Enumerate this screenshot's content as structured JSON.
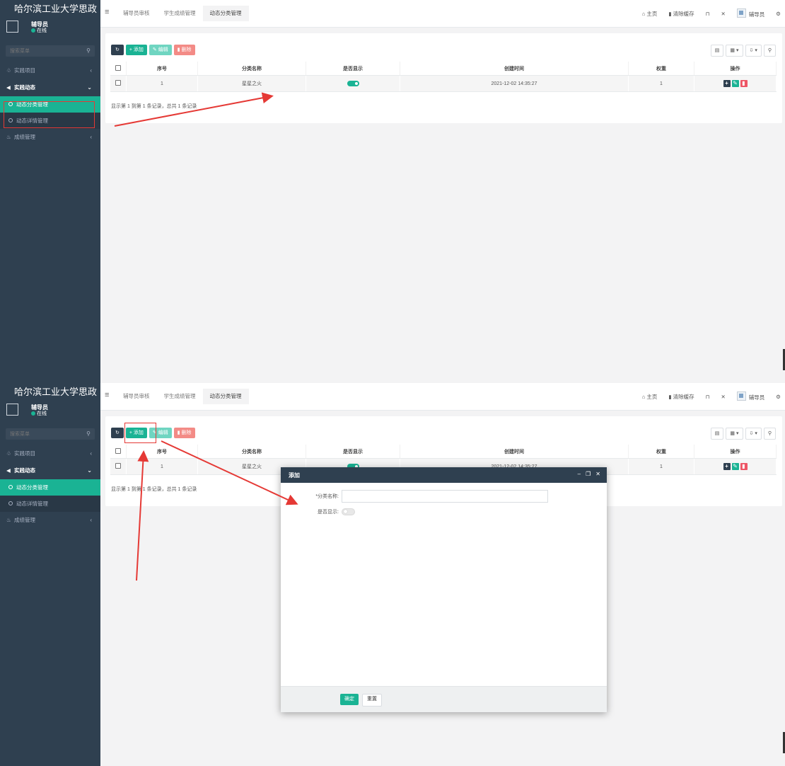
{
  "app": {
    "brand": "哈尔滨工业大学思政",
    "user_name": "辅导员",
    "user_status": "在线",
    "search_placeholder": "搜索菜单"
  },
  "menu": {
    "items": [
      {
        "label": "实践项目",
        "icon": "sitemap-icon"
      },
      {
        "label": "实践动态",
        "icon": "volume-icon"
      },
      {
        "label": "动态分类管理"
      },
      {
        "label": "动态详情管理"
      },
      {
        "label": "成绩管理",
        "icon": "leaf-icon"
      }
    ]
  },
  "tabs": [
    "辅导员审核",
    "学生成绩管理",
    "动态分类管理"
  ],
  "topbar": {
    "home": "主页",
    "clear_cache": "清除缓存",
    "user": "辅导员"
  },
  "toolbar": {
    "add": "添加",
    "edit": "编辑",
    "delete": "删除"
  },
  "table": {
    "columns": [
      "序号",
      "分类名称",
      "是否显示",
      "创建时间",
      "权重",
      "操作"
    ],
    "rows": [
      {
        "index": "1",
        "name": "星星之火",
        "show": true,
        "created": "2021-12-02 14:35:27",
        "weight": "1"
      }
    ],
    "paging": "显示第 1 到第 1 条记录，总共 1 条记录"
  },
  "modal": {
    "title": "添加",
    "field_name_label": "*分类名称:",
    "field_show_label": "是否显示:",
    "field_show_value": false,
    "ok": "确定",
    "reset": "重置"
  },
  "colors": {
    "sidebar": "#2f4050",
    "accent": "#1ab394",
    "danger": "#ed5565",
    "highlight": "#e53935"
  }
}
